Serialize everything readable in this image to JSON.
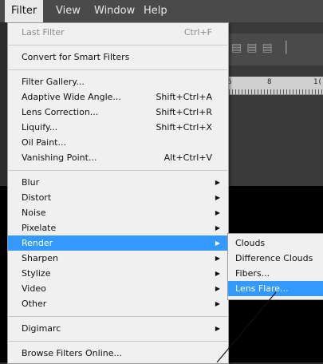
{
  "menubar": {
    "items": [
      {
        "label": "Filter"
      },
      {
        "label": "View"
      },
      {
        "label": "Window"
      },
      {
        "label": "Help"
      }
    ]
  },
  "filter_menu": {
    "last_filter": {
      "label": "Last Filter",
      "shortcut": "Ctrl+F"
    },
    "convert_smart": {
      "label": "Convert for Smart Filters"
    },
    "filter_gallery": {
      "label": "Filter Gallery..."
    },
    "adaptive_wide_angle": {
      "label": "Adaptive Wide Angle...",
      "shortcut": "Shift+Ctrl+A"
    },
    "lens_correction": {
      "label": "Lens Correction...",
      "shortcut": "Shift+Ctrl+R"
    },
    "liquify": {
      "label": "Liquify...",
      "shortcut": "Shift+Ctrl+X"
    },
    "oil_paint": {
      "label": "Oil Paint..."
    },
    "vanishing_point": {
      "label": "Vanishing Point...",
      "shortcut": "Alt+Ctrl+V"
    },
    "blur": {
      "label": "Blur"
    },
    "distort": {
      "label": "Distort"
    },
    "noise": {
      "label": "Noise"
    },
    "pixelate": {
      "label": "Pixelate"
    },
    "render": {
      "label": "Render"
    },
    "sharpen": {
      "label": "Sharpen"
    },
    "stylize": {
      "label": "Stylize"
    },
    "video": {
      "label": "Video"
    },
    "other": {
      "label": "Other"
    },
    "digimarc": {
      "label": "Digimarc"
    },
    "browse_online": {
      "label": "Browse Filters Online..."
    }
  },
  "render_submenu": {
    "clouds": {
      "label": "Clouds"
    },
    "difference_clouds": {
      "label": "Difference Clouds"
    },
    "fibers": {
      "label": "Fibers..."
    },
    "lens_flare": {
      "label": "Lens Flare..."
    }
  },
  "ruler": {
    "tick_6": "6",
    "tick_8": "8",
    "tick_10": "1("
  },
  "colors": {
    "highlight": "#3399ff",
    "menu_bg": "#f0f0f0",
    "menubar_bg": "#4a4a4a"
  }
}
